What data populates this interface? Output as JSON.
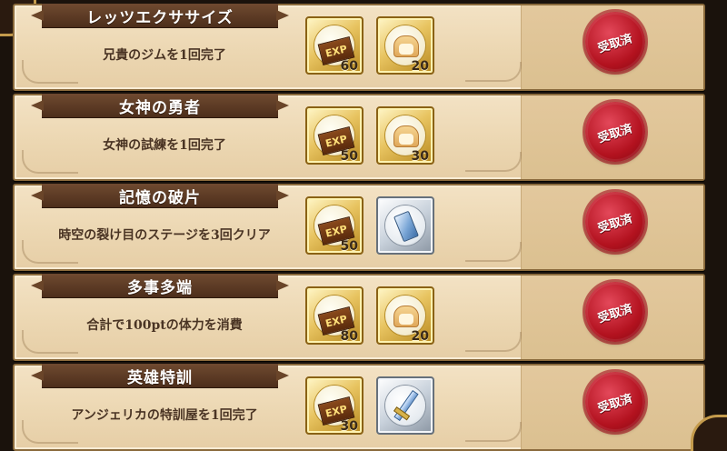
{
  "quests": [
    {
      "title": "レッツエクササイズ",
      "desc": "兄貴のジムを1回完了",
      "rewards": [
        {
          "icon": "exp-ticket-icon",
          "count": "60"
        },
        {
          "icon": "bread-icon",
          "count": "20"
        }
      ],
      "status": "受取済"
    },
    {
      "title": "女神の勇者",
      "desc": "女神の試練を1回完了",
      "rewards": [
        {
          "icon": "exp-ticket-icon",
          "count": "50"
        },
        {
          "icon": "bread-icon",
          "count": "30"
        }
      ],
      "status": "受取済"
    },
    {
      "title": "記憶の破片",
      "desc": "時空の裂け目のステージを3回クリア",
      "rewards": [
        {
          "icon": "exp-ticket-icon",
          "count": "50"
        },
        {
          "icon": "crystal-ticket-icon",
          "count": ""
        }
      ],
      "status": "受取済"
    },
    {
      "title": "多事多端",
      "desc": "合計で100ptの体力を消費",
      "rewards": [
        {
          "icon": "exp-ticket-icon",
          "count": "80"
        },
        {
          "icon": "bread-icon",
          "count": "20"
        }
      ],
      "status": "受取済"
    },
    {
      "title": "英雄特訓",
      "desc": "アンジェリカの特訓屋を1回完了",
      "rewards": [
        {
          "icon": "exp-ticket-icon",
          "count": "30"
        },
        {
          "icon": "sword-icon",
          "count": ""
        }
      ],
      "status": "受取済"
    }
  ],
  "labels": {
    "exp": "EXP"
  },
  "colors": {
    "seal": "#b3121f",
    "banner": "#5a3722",
    "parchment": "#ecd7b2",
    "gold_frame": "#e8c461",
    "silver_frame": "#c9d2dc"
  }
}
